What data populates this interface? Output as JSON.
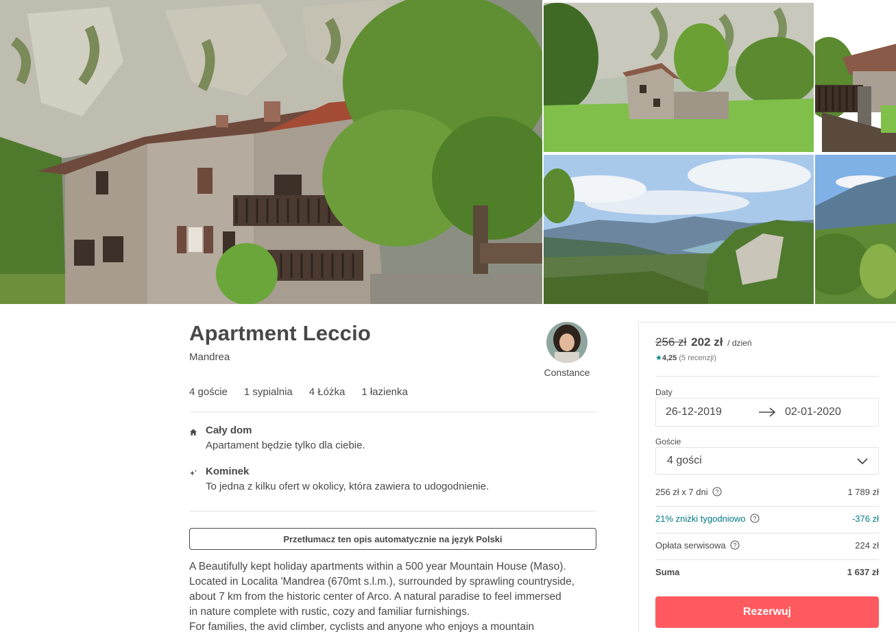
{
  "gallery": {
    "photos": [
      {
        "name": "main",
        "alt_icon": "house-photo"
      },
      {
        "name": "meadow-house",
        "alt_icon": "house-photo"
      },
      {
        "name": "balcony",
        "alt_icon": "house-photo"
      },
      {
        "name": "lake-view",
        "alt_icon": "landscape-photo"
      },
      {
        "name": "mountain-view",
        "alt_icon": "landscape-photo"
      }
    ]
  },
  "listing": {
    "title": "Apartment Leccio",
    "location": "Mandrea",
    "host_name": "Constance",
    "amenities": [
      "4 goście",
      "1 sypialnia",
      "4 Łóżka",
      "1 łazienka"
    ],
    "features": [
      {
        "icon": "home-icon",
        "name": "Cały dom",
        "description": "Apartament będzie tylko dla ciebie."
      },
      {
        "icon": "sparkle-icon",
        "name": "Kominek",
        "description": "To jedna z kilku ofert w okolicy, która zawiera to udogodnienie."
      }
    ],
    "translate_label": "Przetłumacz ten opis automatycznie na język Polski",
    "description_lines": [
      "A Beautifully kept holiday apartments within a 500 year Mountain House (Maso).",
      "Located in Localita 'Mandrea (670mt s.l.m.), surrounded by sprawling countryside,",
      "about 7 km from the historic center of Arco. A natural paradise to feel immersed",
      "in nature complete with rustic, cozy and familiar furnishings.",
      "For families, the avid climber, cyclists and anyone who enjoys a mountain"
    ]
  },
  "booking": {
    "price_old": "256 zł",
    "price_new": "202 zł",
    "price_unit": "/ dzień",
    "rating_star": "★",
    "rating": "4,25",
    "reviews": "(5 recenzji)",
    "dates_label": "Daty",
    "check_in": "26-12-2019",
    "check_out": "02-01-2020",
    "guests_label": "Goście",
    "guests_value": "4 gości",
    "costs": [
      {
        "label": "256 zł x 7 dni",
        "value": "1 789 zł",
        "help": true
      },
      {
        "label": "21% zniżki tygodniowo",
        "value": "-376 zł",
        "help": true
      },
      {
        "label": "Opłata serwisowa",
        "value": "224 zł",
        "help": true
      },
      {
        "label": "Suma",
        "value": "1 637 zł",
        "help": false
      }
    ],
    "reserve_label": "Rezerwuj",
    "colors": {
      "accent": "#ff5a5f",
      "discount": "#007a87",
      "star": "#008489"
    }
  }
}
